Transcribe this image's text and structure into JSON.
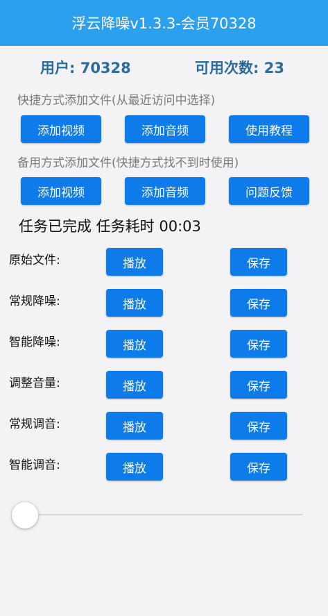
{
  "app": {
    "title": "浮云降噪v1.3.3-会员70328"
  },
  "stats": {
    "user": "用户: 70328",
    "count": "可用次数: 23"
  },
  "hints": {
    "quick": "快捷方式添加文件(从最近访问中选择)",
    "backup": "备用方式添加文件(快捷方式找不到时使用)"
  },
  "quick_buttons": {
    "video": "添加视频",
    "audio": "添加音频",
    "tutorial": "使用教程"
  },
  "backup_buttons": {
    "video": "添加视频",
    "audio": "添加音频",
    "feedback": "问题反馈"
  },
  "status": "任务已完成 任务耗时 00:03",
  "rows": [
    {
      "label": "原始文件:",
      "play": "播放",
      "save": "保存"
    },
    {
      "label": "常规降噪:",
      "play": "播放",
      "save": "保存"
    },
    {
      "label": "智能降噪:",
      "play": "播放",
      "save": "保存"
    },
    {
      "label": "调整音量:",
      "play": "播放",
      "save": "保存"
    },
    {
      "label": "常规调音:",
      "play": "播放",
      "save": "保存"
    },
    {
      "label": "智能调音:",
      "play": "播放",
      "save": "保存"
    }
  ],
  "playback": {
    "progress": 0
  },
  "colors": {
    "accent": "#2aa0ee",
    "button": "#0d7bea",
    "stat_text": "#2c6c9c"
  }
}
